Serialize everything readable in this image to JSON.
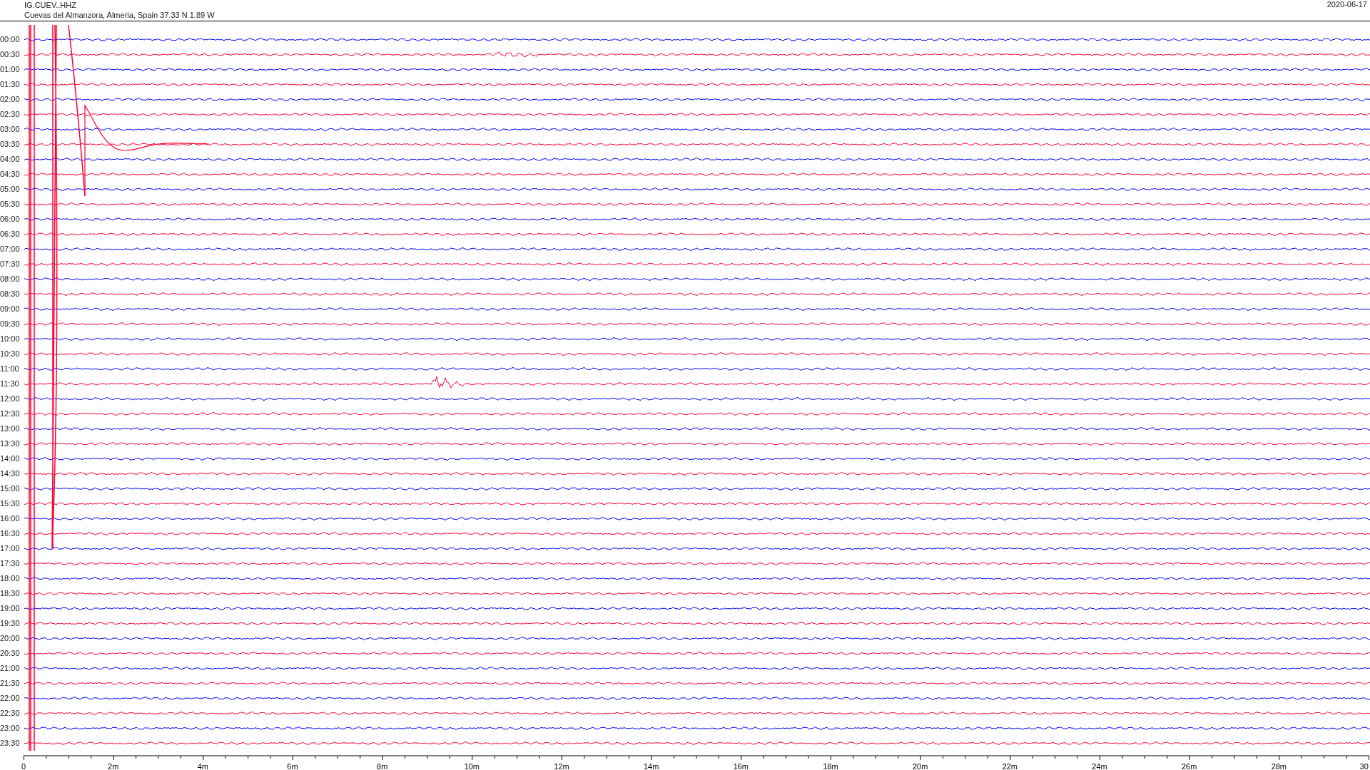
{
  "header": {
    "station": "IG.CUEV..HHZ",
    "location": "Cuevas del Almanzora, Almeria, Spain  37.33 N 1.89 W",
    "date": "2020-06-17"
  },
  "rows": [
    {
      "label": "00:00",
      "color": "#0000ff"
    },
    {
      "label": "00:30",
      "color": "#ff0033"
    },
    {
      "label": "01:00",
      "color": "#0000ff"
    },
    {
      "label": "01:30",
      "color": "#ff0033"
    },
    {
      "label": "02:00",
      "color": "#0000ff"
    },
    {
      "label": "02:30",
      "color": "#ff0033"
    },
    {
      "label": "03:00",
      "color": "#0000ff"
    },
    {
      "label": "03:30",
      "color": "#ff0033"
    },
    {
      "label": "04:00",
      "color": "#0000ff"
    },
    {
      "label": "04:30",
      "color": "#ff0033"
    },
    {
      "label": "05:00",
      "color": "#0000ff"
    },
    {
      "label": "05:30",
      "color": "#ff0033"
    },
    {
      "label": "06:00",
      "color": "#0000ff"
    },
    {
      "label": "06:30",
      "color": "#ff0033"
    },
    {
      "label": "07:00",
      "color": "#0000ff"
    },
    {
      "label": "07:30",
      "color": "#ff0033"
    },
    {
      "label": "08:00",
      "color": "#0000ff"
    },
    {
      "label": "08:30",
      "color": "#ff0033"
    },
    {
      "label": "09:00",
      "color": "#0000ff"
    },
    {
      "label": "09:30",
      "color": "#ff0033"
    },
    {
      "label": "10:00",
      "color": "#0000ff"
    },
    {
      "label": "10:30",
      "color": "#ff0033"
    },
    {
      "label": "11:00",
      "color": "#0000ff"
    },
    {
      "label": "11:30",
      "color": "#ff0033"
    },
    {
      "label": "12:00",
      "color": "#0000ff"
    },
    {
      "label": "12:30",
      "color": "#ff0033"
    },
    {
      "label": "13:00",
      "color": "#0000ff"
    },
    {
      "label": "13:30",
      "color": "#ff0033"
    },
    {
      "label": "14:00",
      "color": "#0000ff"
    },
    {
      "label": "14:30",
      "color": "#ff0033"
    },
    {
      "label": "15:00",
      "color": "#0000ff"
    },
    {
      "label": "15:30",
      "color": "#ff0033"
    },
    {
      "label": "16:00",
      "color": "#0000ff"
    },
    {
      "label": "16:30",
      "color": "#ff0033"
    },
    {
      "label": "17:00",
      "color": "#0000ff"
    },
    {
      "label": "17:30",
      "color": "#ff0033"
    },
    {
      "label": "18:00",
      "color": "#0000ff"
    },
    {
      "label": "18:30",
      "color": "#ff0033"
    },
    {
      "label": "19:00",
      "color": "#0000ff"
    },
    {
      "label": "19:30",
      "color": "#ff0033"
    },
    {
      "label": "20:00",
      "color": "#0000ff"
    },
    {
      "label": "20:30",
      "color": "#ff0033"
    },
    {
      "label": "21:00",
      "color": "#0000ff"
    },
    {
      "label": "21:30",
      "color": "#ff0033"
    },
    {
      "label": "22:00",
      "color": "#0000ff"
    },
    {
      "label": "22:30",
      "color": "#ff0033"
    },
    {
      "label": "23:00",
      "color": "#0000ff"
    },
    {
      "label": "23:30",
      "color": "#ff0033"
    }
  ],
  "x_axis": {
    "ticks": [
      "0",
      "2m",
      "4m",
      "6m",
      "8m",
      "10m",
      "12m",
      "14m",
      "16m",
      "18m",
      "20m",
      "22m",
      "24m",
      "26m",
      "28m",
      "30"
    ]
  }
}
